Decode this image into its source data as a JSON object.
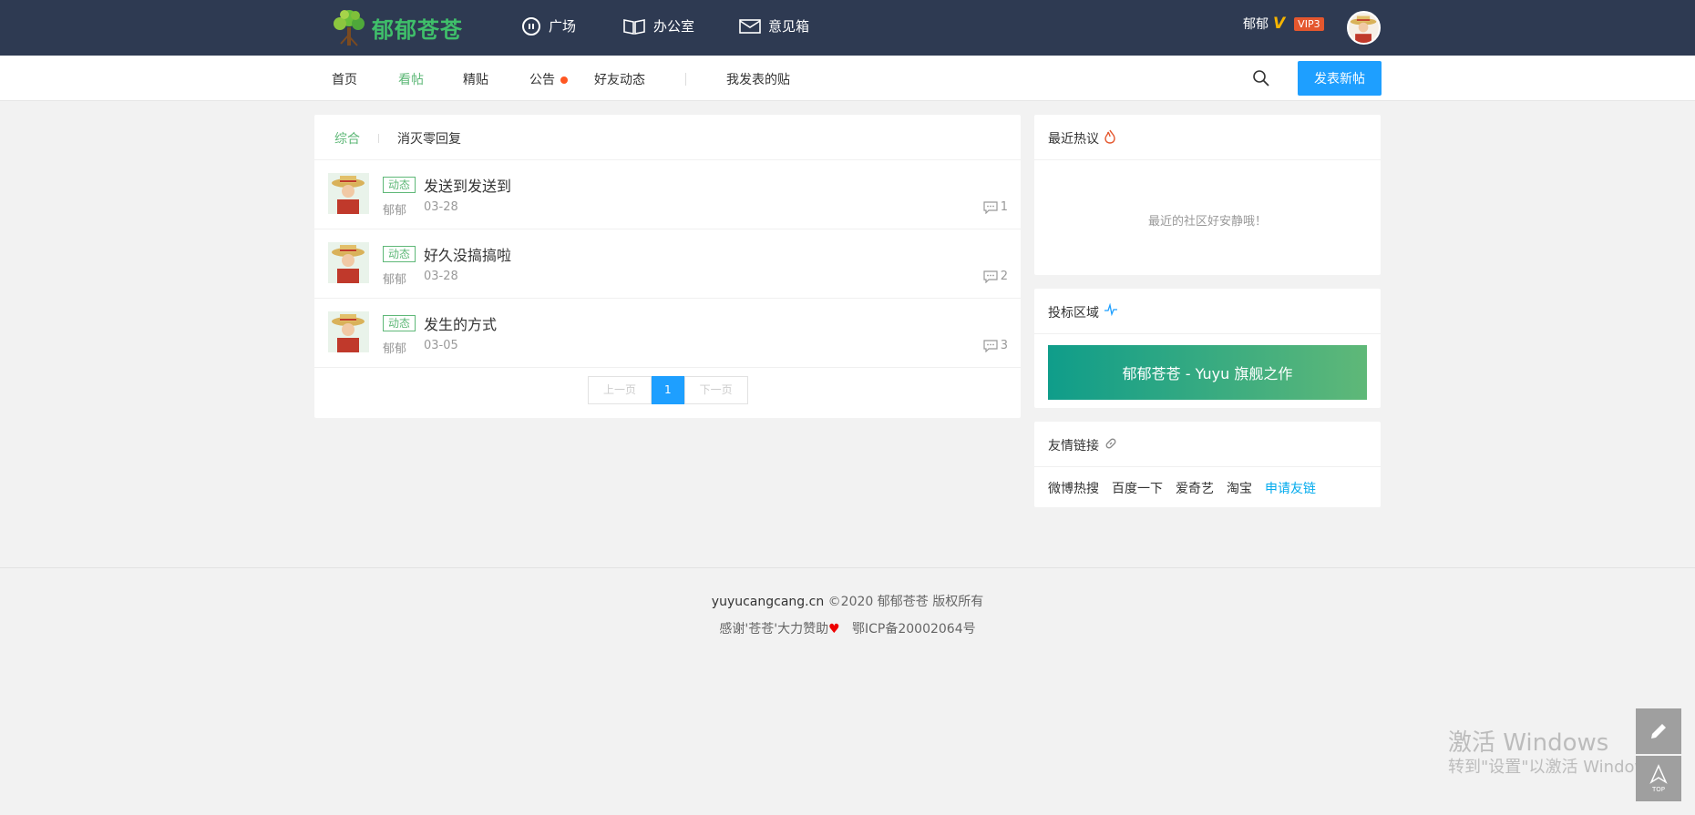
{
  "header": {
    "logo_text": "郁郁苍苍",
    "nav": [
      {
        "label": "广场",
        "icon": "chat-bubble-icon"
      },
      {
        "label": "办公室",
        "icon": "book-icon"
      },
      {
        "label": "意见箱",
        "icon": "mail-icon"
      }
    ],
    "username": "郁郁",
    "vip_mark": "V",
    "vip_level": "VIP3"
  },
  "subnav": {
    "items": [
      "首页",
      "看帖",
      "精贴",
      "公告",
      "好友动态"
    ],
    "active": "看帖",
    "my_posts": "我发表的贴",
    "new_post_button": "发表新帖"
  },
  "main": {
    "tabs": [
      "综合",
      "消灭零回复"
    ],
    "posts": [
      {
        "tag": "动态",
        "title": "发送到发送到",
        "author": "郁郁",
        "date": "03-28",
        "comments": "1"
      },
      {
        "tag": "动态",
        "title": "好久没搞搞啦",
        "author": "郁郁",
        "date": "03-28",
        "comments": "2"
      },
      {
        "tag": "动态",
        "title": "发生的方式",
        "author": "郁郁",
        "date": "03-05",
        "comments": "3"
      }
    ],
    "pager": {
      "prev": "上一页",
      "current": "1",
      "next": "下一页"
    }
  },
  "sidebar": {
    "hot_title": "最近热议",
    "hot_empty": "最近的社区好安静哦！",
    "ad_title": "投标区域",
    "ad_banner": "郁郁苍苍 - Yuyu 旗舰之作",
    "links_title": "友情链接",
    "links": [
      "微博热搜",
      "百度一下",
      "爱奇艺",
      "淘宝"
    ],
    "apply_link": "申请友链"
  },
  "footer": {
    "site": "yuyucangcang.cn",
    "copyright": "©2020  郁郁苍苍 版权所有",
    "thanks": "感谢'苍苍'大力赞助",
    "icp": "鄂ICP备20002064号"
  },
  "watermark": {
    "line1": "激活 Windows",
    "line2": "转到\"设置\"以激活 Windows。"
  },
  "fixed_buttons": {
    "top_label": "TOP"
  },
  "colors": {
    "header_bg": "#2e3a52",
    "accent_green": "#5fb878",
    "primary_blue": "#1e9fff",
    "vip": "#e4572e"
  }
}
